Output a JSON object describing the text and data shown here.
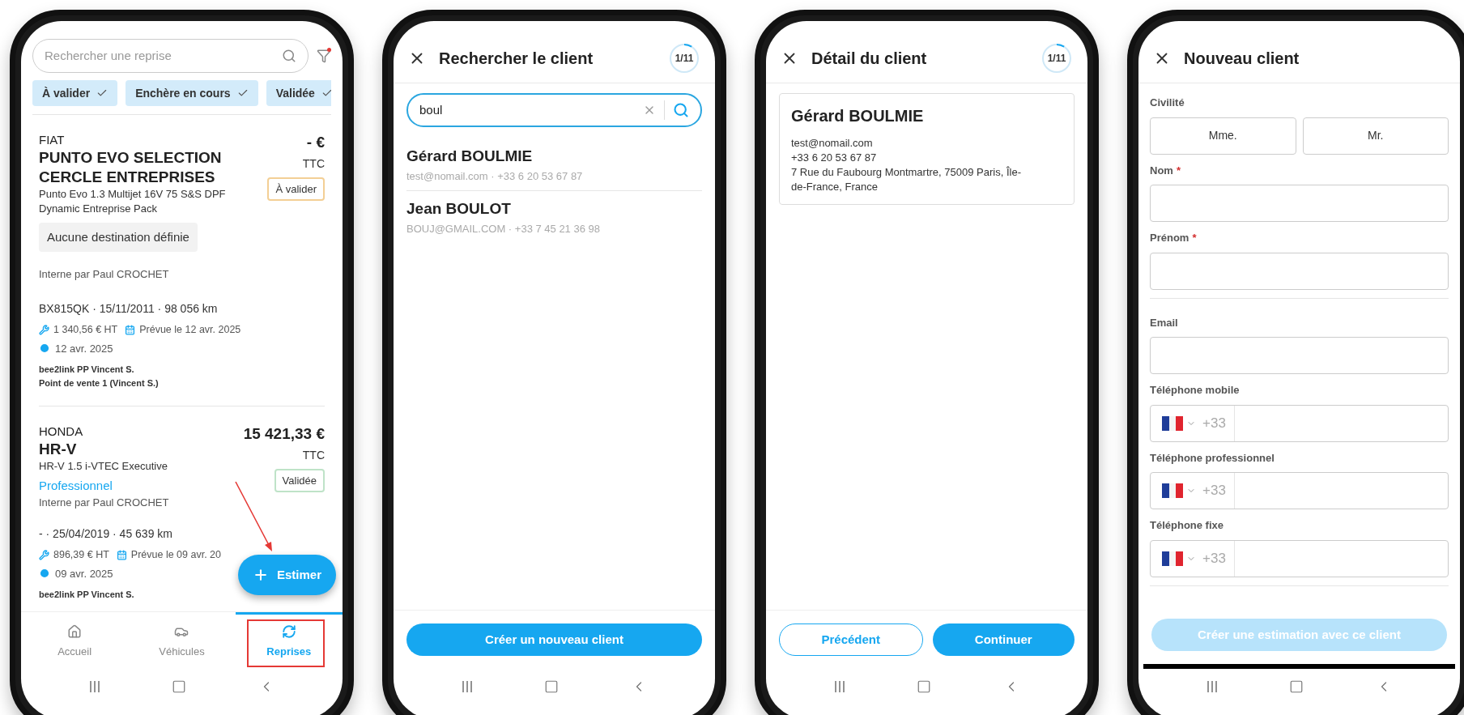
{
  "screens": [
    {
      "kind": "reprises",
      "search": {
        "placeholder": "Rechercher une reprise"
      },
      "filter_chips": [
        {
          "label": "À valider",
          "selected": true
        },
        {
          "label": "Enchère en cours",
          "selected": true
        },
        {
          "label": "Validée",
          "selected": true
        }
      ],
      "cards": [
        {
          "brand": "FIAT",
          "model": "PUNTO EVO SELECTION CERCLE ENTREPRISES",
          "version": "Punto Evo 1.3 Multijet 16V 75 S&S DPF Dynamic Entreprise Pack",
          "price": "- €",
          "price_note": "TTC",
          "status": {
            "label": "À valider",
            "color": "#f3cf95"
          },
          "destination": "Aucune destination définie",
          "origin": "Interne par Paul CROCHET",
          "vehicle": "BX815QK · 15/11/2011 · 98 056 km",
          "cost": "1 340,56 € HT",
          "planned": "Prévue le 12 avr. 2025",
          "date": "12 avr. 2025",
          "seller": "bee2link PP Vincent S.",
          "point_of_sale": "Point de vente 1 (Vincent S.)"
        },
        {
          "brand": "HONDA",
          "model": "HR-V",
          "version": "HR-V 1.5  i-VTEC Executive",
          "price": "15 421,33 €",
          "price_note": "TTC",
          "status": {
            "label": "Validée",
            "color": "#bfe3c8"
          },
          "channel": "Professionnel",
          "origin": "Interne par Paul CROCHET",
          "vehicle": "- · 25/04/2019 · 45 639 km",
          "cost": "896,39 € HT",
          "planned": "Prévue le 09 avr. 20",
          "date": "09 avr. 2025",
          "seller": "bee2link PP Vincent S."
        }
      ],
      "fab": {
        "label": "Estimer"
      },
      "bottom_nav": [
        {
          "label": "Accueil",
          "kind": "home",
          "selected": false
        },
        {
          "label": "Véhicules",
          "kind": "car",
          "selected": false
        },
        {
          "label": "Reprises",
          "kind": "trade",
          "selected": true
        }
      ]
    },
    {
      "kind": "client_search",
      "title": "Rechercher le client",
      "progress": {
        "label": "1/11",
        "level": 0.09
      },
      "search": {
        "value": "boul"
      },
      "results": [
        {
          "name": "Gérard BOULMIE",
          "detail": "test@nomail.com · +33 6 20 53 67 87"
        },
        {
          "name": "Jean BOULOT",
          "detail": "BOUJ@GMAIL.COM · +33 7 45 21 36 98"
        }
      ],
      "buttons": [
        {
          "label": "Créer un nouveau client",
          "kind": "primary",
          "disabled": false
        }
      ]
    },
    {
      "kind": "client_detail",
      "title": "Détail du client",
      "progress": {
        "label": "1/11",
        "level": 0.09
      },
      "client": {
        "name": "Gérard BOULMIE",
        "lines": [
          "test@nomail.com",
          "+33 6 20 53 67 87",
          "7 Rue du Faubourg Montmartre, 75009 Paris, Île-de-France, France"
        ]
      },
      "buttons": [
        {
          "label": "Précédent",
          "kind": "secondary",
          "disabled": false
        },
        {
          "label": "Continuer",
          "kind": "primary",
          "disabled": false
        }
      ]
    },
    {
      "kind": "new_client",
      "title": "Nouveau client",
      "fields": [
        {
          "kind": "choice",
          "label": "Civilité",
          "options": [
            {
              "label": "Mme.",
              "selected": false
            },
            {
              "label": "Mr.",
              "selected": false
            }
          ],
          "section_end": false
        },
        {
          "kind": "text",
          "label": "Nom",
          "required_mark": "*",
          "section_end": false
        },
        {
          "kind": "text",
          "label": "Prénom",
          "required_mark": "*",
          "section_end": true
        },
        {
          "kind": "text",
          "label": "Email",
          "section_end": false
        },
        {
          "kind": "phone",
          "label": "Téléphone mobile",
          "prefix": "+33",
          "section_end": false
        },
        {
          "kind": "phone",
          "label": "Téléphone professionnel",
          "prefix": "+33",
          "section_end": false
        },
        {
          "kind": "phone",
          "label": "Téléphone fixe",
          "prefix": "+33",
          "section_end": true
        }
      ],
      "buttons": [
        {
          "label": "Créer une estimation avec ce client",
          "kind": "primary",
          "disabled": true
        }
      ]
    }
  ]
}
